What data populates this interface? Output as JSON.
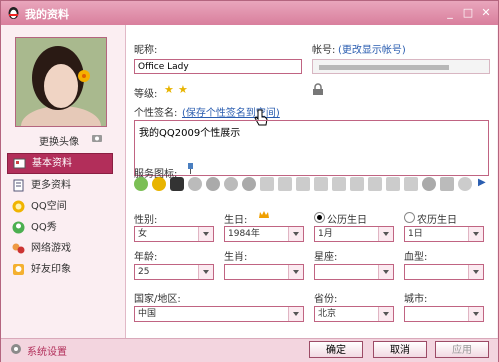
{
  "window": {
    "title": "我的资料"
  },
  "left": {
    "change_avatar": "更换头像",
    "nav": [
      {
        "label": "基本资料"
      },
      {
        "label": "更多资料"
      },
      {
        "label": "QQ空间"
      },
      {
        "label": "QQ秀"
      },
      {
        "label": "网络游戏"
      },
      {
        "label": "好友印象"
      }
    ]
  },
  "profile": {
    "nickname_label": "昵称:",
    "nickname_value": "Office Lady",
    "account_label": "帐号:",
    "account_link": "(更改显示帐号)",
    "level_label": "等级:",
    "signature_label": "个性签名:",
    "signature_link": "(保存个性签名到空间)",
    "signature_value": "我的QQ2009个性展示",
    "service_icons_label": "服务图标:"
  },
  "fields": {
    "gender_label": "性别:",
    "gender_value": "女",
    "birthday_label": "生日:",
    "year_value": "1984年",
    "solar_label": "公历生日",
    "lunar_label": "农历生日",
    "month_value": "1月",
    "day_value": "1日",
    "age_label": "年龄:",
    "age_value": "25",
    "zodiac_label": "生肖:",
    "star_label": "星座:",
    "blood_label": "血型:",
    "country_label": "国家/地区:",
    "country_value": "中国",
    "province_label": "省份:",
    "province_value": "北京",
    "city_label": "城市:"
  },
  "footer": {
    "settings": "系统设置",
    "ok": "确定",
    "cancel": "取消",
    "apply": "应用"
  },
  "colors": {
    "accent": "#b22e5a",
    "title_bar": "#d97f9d",
    "border": "#c06482"
  }
}
